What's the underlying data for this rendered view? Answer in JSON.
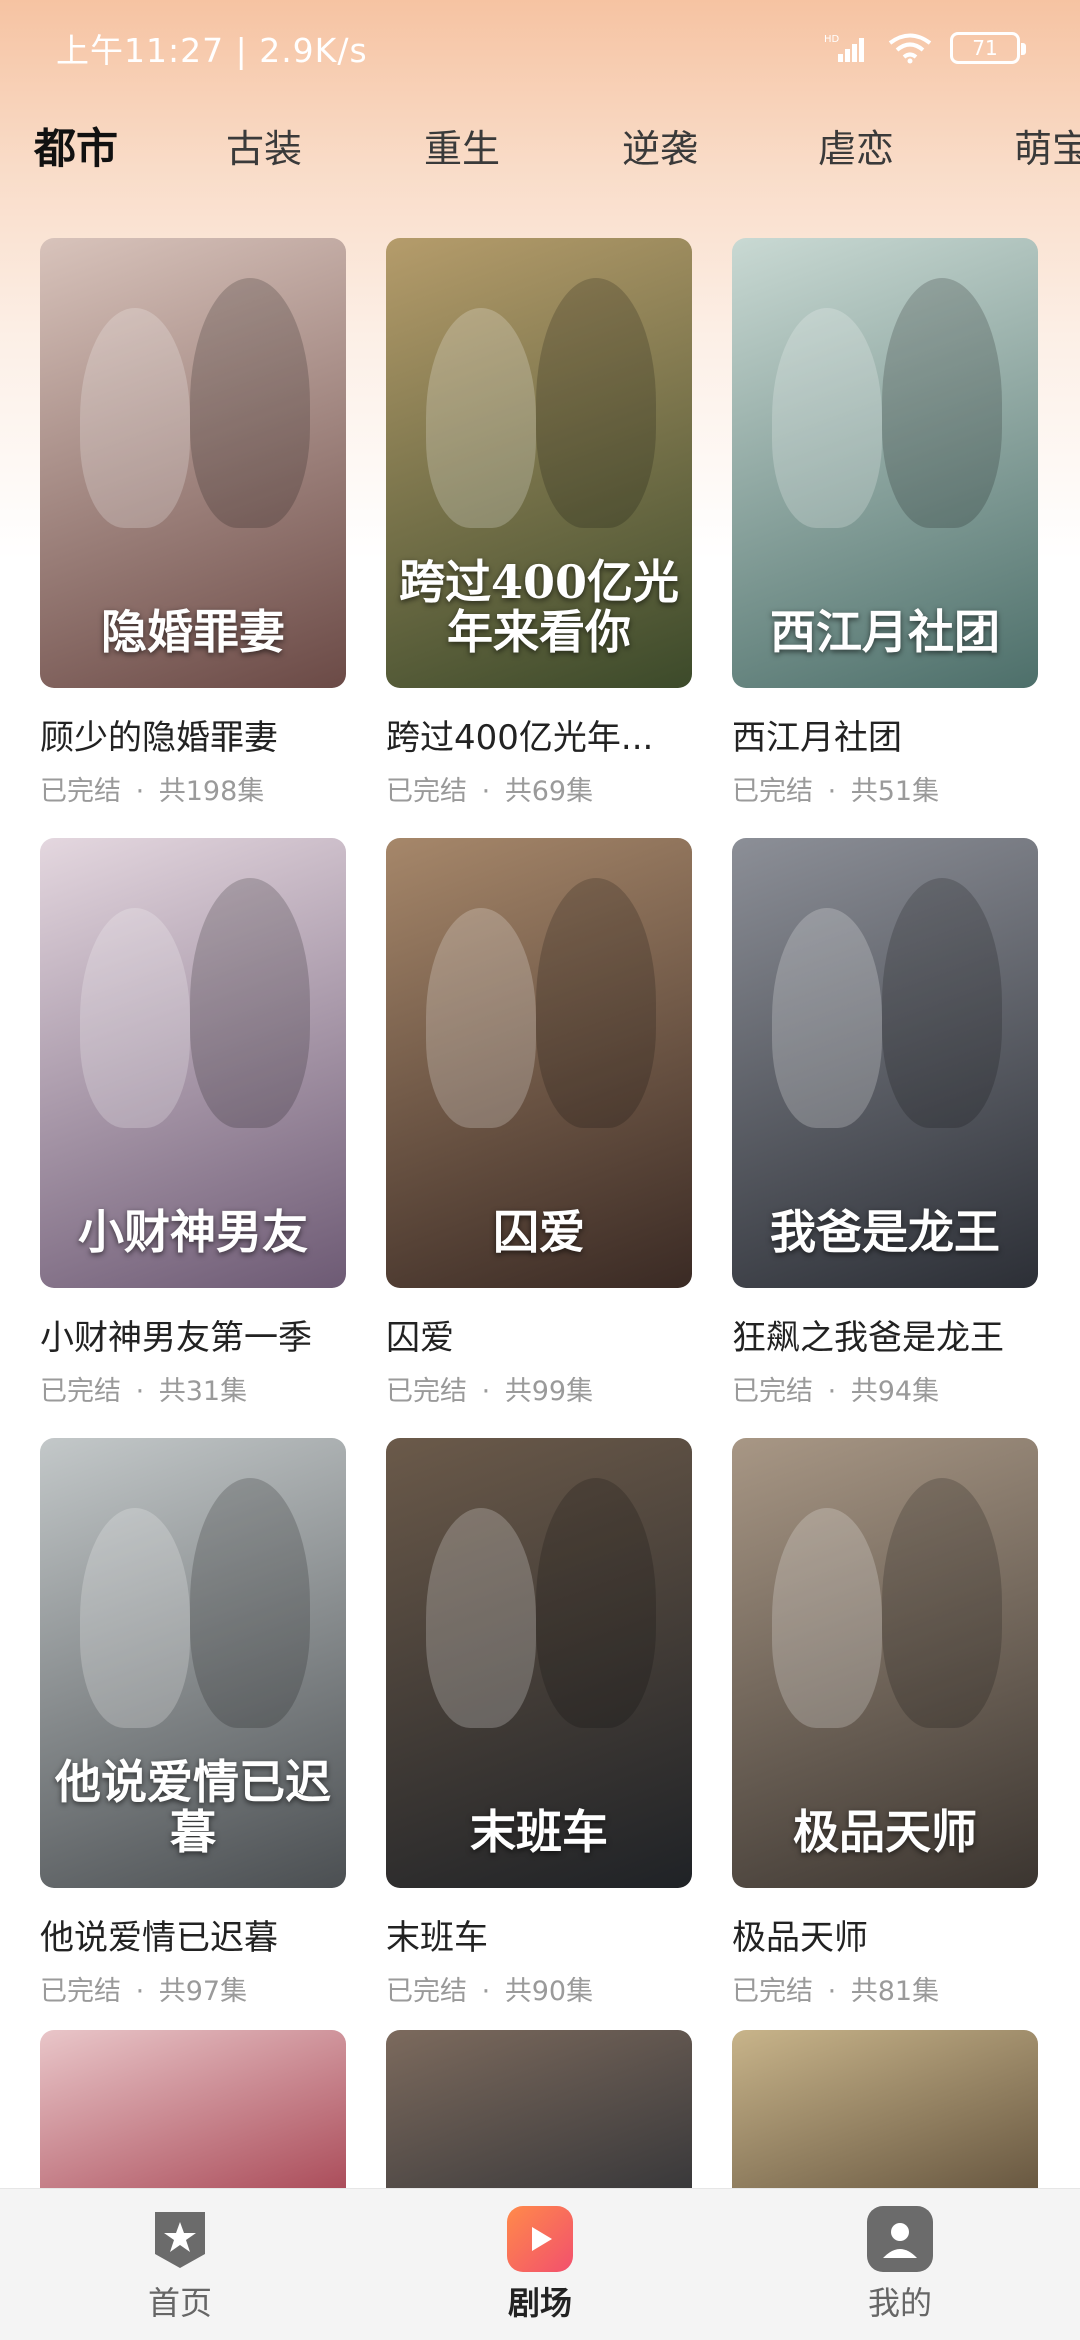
{
  "status_bar": {
    "time": "上午11:27 | 2.9K/s",
    "signal_label": "HD",
    "battery": "71"
  },
  "tabs": [
    {
      "label": "都市",
      "active": true
    },
    {
      "label": "古装",
      "active": false
    },
    {
      "label": "重生",
      "active": false
    },
    {
      "label": "逆袭",
      "active": false
    },
    {
      "label": "虐恋",
      "active": false
    },
    {
      "label": "萌宝",
      "active": false
    }
  ],
  "dramas": [
    {
      "title": "顾少的隐婚罪妻",
      "status": "已完结",
      "episodes": "共198集",
      "poster_text": "隐婚罪妻",
      "colors": [
        "#6b4a46",
        "#d8c3bb"
      ]
    },
    {
      "title": "跨过400亿光年...",
      "status": "已完结",
      "episodes": "共69集",
      "poster_text": "跨过400亿光年来看你",
      "colors": [
        "#3c4a2a",
        "#b59c6b"
      ]
    },
    {
      "title": "西江月社团",
      "status": "已完结",
      "episodes": "共51集",
      "poster_text": "西江月社团",
      "colors": [
        "#4d6f6a",
        "#c9d9d3"
      ]
    },
    {
      "title": "小财神男友第一季",
      "status": "已完结",
      "episodes": "共31集",
      "poster_text": "小财神男友",
      "colors": [
        "#6d5a74",
        "#e4d7df"
      ]
    },
    {
      "title": "囚爱",
      "status": "已完结",
      "episodes": "共99集",
      "poster_text": "囚爱",
      "colors": [
        "#3a2a24",
        "#a6876a"
      ]
    },
    {
      "title": "狂飙之我爸是龙王",
      "status": "已完结",
      "episodes": "共94集",
      "poster_text": "我爸是龙王",
      "colors": [
        "#2c2f36",
        "#8c8f97"
      ]
    },
    {
      "title": "他说爱情已迟暮",
      "status": "已完结",
      "episodes": "共97集",
      "poster_text": "他说爱情已迟暮",
      "colors": [
        "#4b4f52",
        "#c3c8c9"
      ]
    },
    {
      "title": "末班车",
      "status": "已完结",
      "episodes": "共90集",
      "poster_text": "末班车",
      "colors": [
        "#1f2226",
        "#6b5a4a"
      ]
    },
    {
      "title": "极品天师",
      "status": "已完结",
      "episodes": "共81集",
      "poster_text": "极品天师",
      "colors": [
        "#3b3530",
        "#a89785"
      ]
    }
  ],
  "partial_posters": [
    {
      "colors": [
        "#a23b4a",
        "#e9c6c9"
      ]
    },
    {
      "colors": [
        "#2f3135",
        "#7c6a5d"
      ]
    },
    {
      "colors": [
        "#5a4a36",
        "#c8b48a"
      ]
    }
  ],
  "bottom_nav": [
    {
      "label": "首页",
      "icon": "home-badge-icon",
      "active": false
    },
    {
      "label": "剧场",
      "icon": "play-icon",
      "active": true
    },
    {
      "label": "我的",
      "icon": "user-icon",
      "active": false
    }
  ],
  "colors": {
    "accent": "#f2506d",
    "meta_text": "#9a9a9a"
  }
}
